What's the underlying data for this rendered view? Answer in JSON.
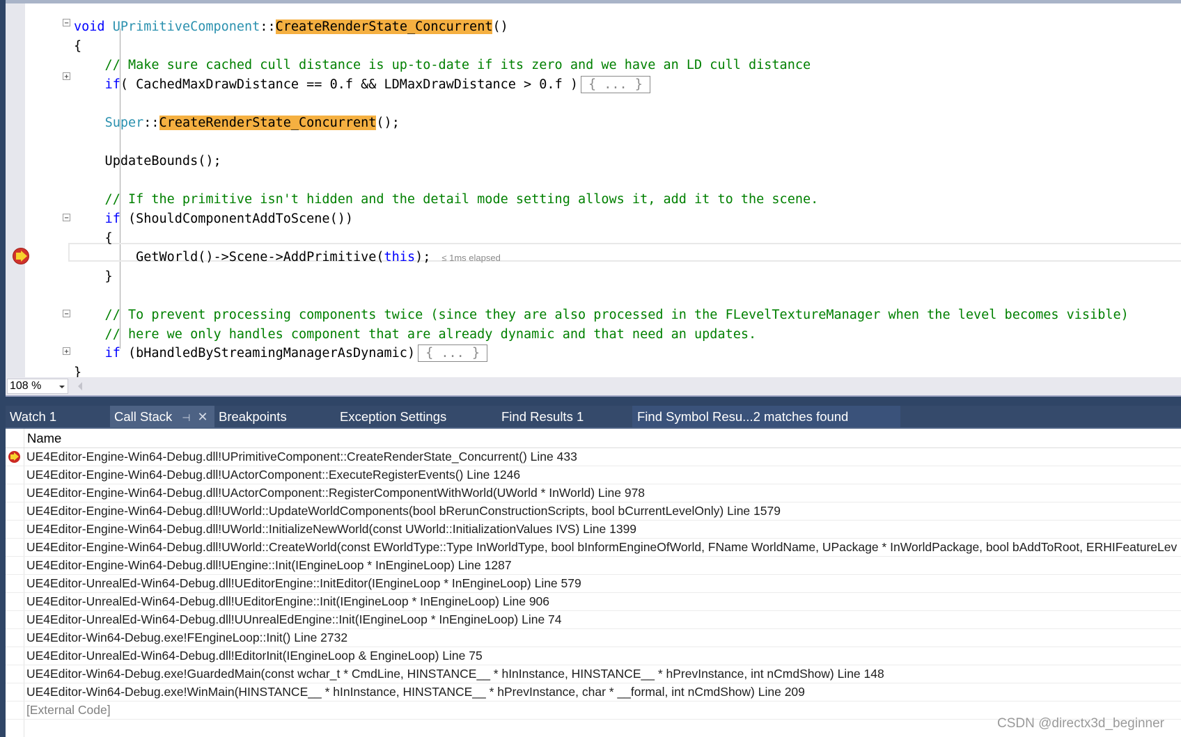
{
  "editor": {
    "zoom_level": "108 %",
    "lines": [
      {
        "parts": [
          {
            "t": "void",
            "c": "kw"
          },
          {
            "t": " "
          },
          {
            "t": "UPrimitiveComponent",
            "c": "ty"
          },
          {
            "t": "::"
          },
          {
            "t": "CreateRenderState_Concurrent",
            "c": "hl"
          },
          {
            "t": "()"
          }
        ]
      },
      {
        "parts": [
          {
            "t": "{"
          }
        ]
      },
      {
        "parts": [
          {
            "t": "    // Make sure cached cull distance is up-to-date if its zero and we have an LD cull distance",
            "c": "cm"
          }
        ]
      },
      {
        "parts": [
          {
            "t": "    "
          },
          {
            "t": "if",
            "c": "kw"
          },
          {
            "t": "( CachedMaxDrawDistance == 0.f && LDMaxDrawDistance > 0.f )"
          }
        ],
        "collapsed": "{ ... }"
      },
      {
        "parts": [
          {
            "t": ""
          }
        ]
      },
      {
        "parts": [
          {
            "t": "    "
          },
          {
            "t": "Super",
            "c": "ty"
          },
          {
            "t": "::"
          },
          {
            "t": "CreateRenderState_Concurrent",
            "c": "hl"
          },
          {
            "t": "();"
          }
        ]
      },
      {
        "parts": [
          {
            "t": ""
          }
        ]
      },
      {
        "parts": [
          {
            "t": "    UpdateBounds();"
          }
        ]
      },
      {
        "parts": [
          {
            "t": ""
          }
        ]
      },
      {
        "parts": [
          {
            "t": "    // If the primitive isn't hidden and the detail mode setting allows it, add it to the scene.",
            "c": "cm"
          }
        ]
      },
      {
        "parts": [
          {
            "t": "    "
          },
          {
            "t": "if",
            "c": "kw"
          },
          {
            "t": " (ShouldComponentAddToScene())"
          }
        ]
      },
      {
        "parts": [
          {
            "t": "    {"
          }
        ]
      },
      {
        "parts": [
          {
            "t": "        GetWorld()->Scene->AddPrimitive("
          },
          {
            "t": "this",
            "c": "kw"
          },
          {
            "t": ");"
          }
        ],
        "elapsed": "≤ 1ms elapsed"
      },
      {
        "parts": [
          {
            "t": "    }"
          }
        ]
      },
      {
        "parts": [
          {
            "t": ""
          }
        ]
      },
      {
        "parts": [
          {
            "t": "    // To prevent processing components twice (since they are also processed in the FLevelTextureManager when the level becomes visible)",
            "c": "cm"
          }
        ]
      },
      {
        "parts": [
          {
            "t": "    // here we only handles component that are already dynamic and that need an updates.",
            "c": "cm"
          }
        ]
      },
      {
        "parts": [
          {
            "t": "    "
          },
          {
            "t": "if",
            "c": "kw"
          },
          {
            "t": " (bHandledByStreamingManagerAsDynamic)"
          }
        ],
        "collapsed": "{ ... }"
      },
      {
        "parts": [
          {
            "t": "}"
          }
        ]
      }
    ]
  },
  "tabs": [
    {
      "label": "Watch 1",
      "active": false
    },
    {
      "label": "Call Stack",
      "active": true,
      "pin": "⊣",
      "close": "✕"
    },
    {
      "label": "Breakpoints",
      "active": false
    },
    {
      "label": "Exception Settings",
      "active": false
    },
    {
      "label": "Find Results 1",
      "active": false
    },
    {
      "label": "Find Symbol Resu...2 matches found",
      "active": false
    }
  ],
  "call_stack": {
    "column_header": "Name",
    "rows": [
      {
        "text": "UE4Editor-Engine-Win64-Debug.dll!UPrimitiveComponent::CreateRenderState_Concurrent() Line 433",
        "current": true
      },
      {
        "text": "UE4Editor-Engine-Win64-Debug.dll!UActorComponent::ExecuteRegisterEvents() Line 1246"
      },
      {
        "text": "UE4Editor-Engine-Win64-Debug.dll!UActorComponent::RegisterComponentWithWorld(UWorld * InWorld) Line 978"
      },
      {
        "text": "UE4Editor-Engine-Win64-Debug.dll!UWorld::UpdateWorldComponents(bool bRerunConstructionScripts, bool bCurrentLevelOnly) Line 1579"
      },
      {
        "text": "UE4Editor-Engine-Win64-Debug.dll!UWorld::InitializeNewWorld(const UWorld::InitializationValues IVS) Line 1399"
      },
      {
        "text": "UE4Editor-Engine-Win64-Debug.dll!UWorld::CreateWorld(const EWorldType::Type InWorldType, bool bInformEngineOfWorld, FName WorldName, UPackage * InWorldPackage, bool bAddToRoot, ERHIFeatureLev"
      },
      {
        "text": "UE4Editor-Engine-Win64-Debug.dll!UEngine::Init(IEngineLoop * InEngineLoop) Line 1287"
      },
      {
        "text": "UE4Editor-UnrealEd-Win64-Debug.dll!UEditorEngine::InitEditor(IEngineLoop * InEngineLoop) Line 579"
      },
      {
        "text": "UE4Editor-UnrealEd-Win64-Debug.dll!UEditorEngine::Init(IEngineLoop * InEngineLoop) Line 906"
      },
      {
        "text": "UE4Editor-UnrealEd-Win64-Debug.dll!UUnrealEdEngine::Init(IEngineLoop * InEngineLoop) Line 74"
      },
      {
        "text": "UE4Editor-Win64-Debug.exe!FEngineLoop::Init() Line 2732"
      },
      {
        "text": "UE4Editor-UnrealEd-Win64-Debug.dll!EditorInit(IEngineLoop & EngineLoop) Line 75"
      },
      {
        "text": "UE4Editor-Win64-Debug.exe!GuardedMain(const wchar_t * CmdLine, HINSTANCE__ * hInInstance, HINSTANCE__ * hPrevInstance, int nCmdShow) Line 148"
      },
      {
        "text": "UE4Editor-Win64-Debug.exe!WinMain(HINSTANCE__ * hInInstance, HINSTANCE__ * hPrevInstance, char * __formal, int nCmdShow) Line 209"
      },
      {
        "text": "[External Code]",
        "external": true
      }
    ]
  },
  "watermark": "CSDN @directx3d_beginner",
  "colors": {
    "keyword": "#0000ff",
    "type": "#2b91af",
    "comment": "#008000",
    "find_highlight": "#f5b041",
    "tab_strip": "#354a6b",
    "active_tab": "#4d6284"
  }
}
